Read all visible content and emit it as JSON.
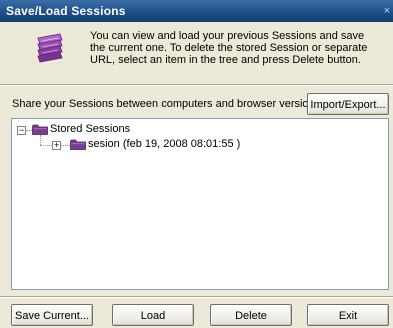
{
  "window": {
    "title": "Save/Load Sessions",
    "close_glyph": "×"
  },
  "header": {
    "icon": "sessions-stack-icon",
    "description": "You can view and load your previous Sessions and save the current one. To delete the stored Session or separate URL, select an item in the tree and press Delete button."
  },
  "share": {
    "label": "Share your Sessions between computers and browser versions.",
    "import_export_label": "Import/Export..."
  },
  "tree": {
    "root": {
      "expander": "−",
      "label": "Stored Sessions",
      "icon": "folder-icon"
    },
    "children": [
      {
        "expander": "+",
        "label": "sesion (feb 19, 2008 08:01:55 )",
        "icon": "folder-icon"
      }
    ]
  },
  "buttons": {
    "save_current": "Save Current...",
    "load": "Load",
    "delete": "Delete",
    "exit": "Exit"
  },
  "colors": {
    "titlebar": "#1f4f8c",
    "dialog_bg": "#ece9d8",
    "folder_purple": "#7a3c8f",
    "icon_purple": "#9b4fb5"
  }
}
